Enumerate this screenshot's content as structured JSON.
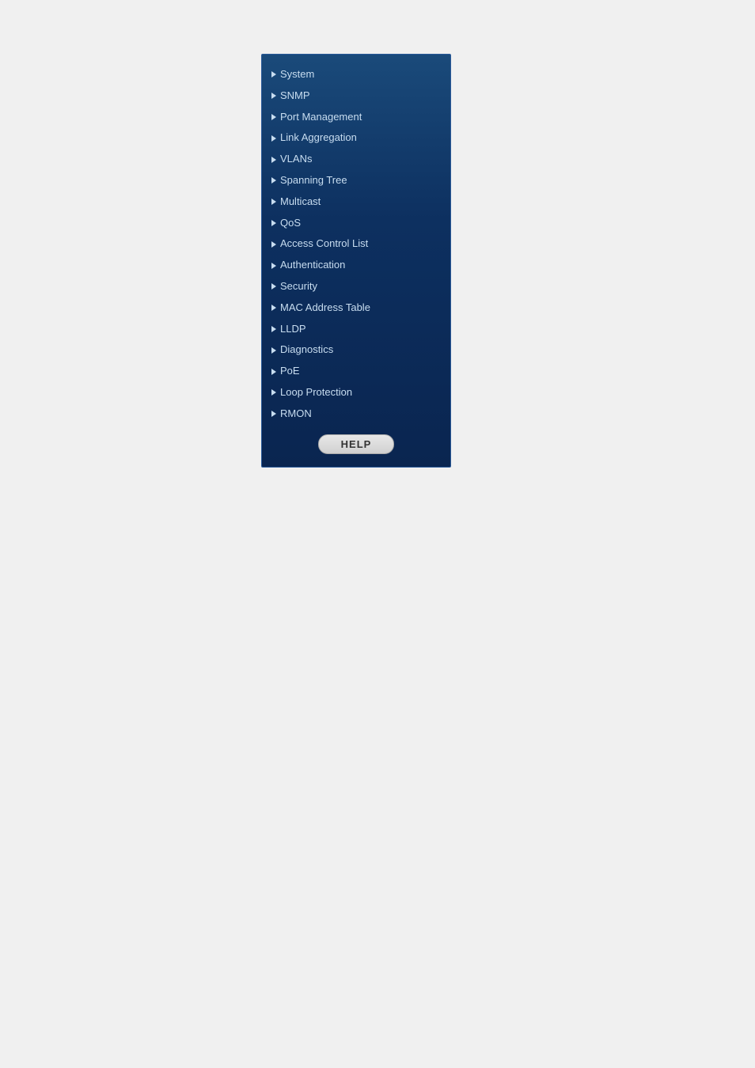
{
  "nav": {
    "items": [
      {
        "id": "system",
        "label": "System"
      },
      {
        "id": "snmp",
        "label": "SNMP"
      },
      {
        "id": "port-management",
        "label": "Port Management"
      },
      {
        "id": "link-aggregation",
        "label": "Link Aggregation"
      },
      {
        "id": "vlans",
        "label": "VLANs"
      },
      {
        "id": "spanning-tree",
        "label": "Spanning Tree"
      },
      {
        "id": "multicast",
        "label": "Multicast"
      },
      {
        "id": "qos",
        "label": "QoS"
      },
      {
        "id": "access-control-list",
        "label": "Access Control List"
      },
      {
        "id": "authentication",
        "label": "Authentication"
      },
      {
        "id": "security",
        "label": "Security"
      },
      {
        "id": "mac-address-table",
        "label": "MAC Address Table"
      },
      {
        "id": "lldp",
        "label": "LLDP"
      },
      {
        "id": "diagnostics",
        "label": "Diagnostics"
      },
      {
        "id": "poe",
        "label": "PoE"
      },
      {
        "id": "loop-protection",
        "label": "Loop Protection"
      },
      {
        "id": "rmon",
        "label": "RMON"
      }
    ],
    "help_button_label": "HELP"
  }
}
